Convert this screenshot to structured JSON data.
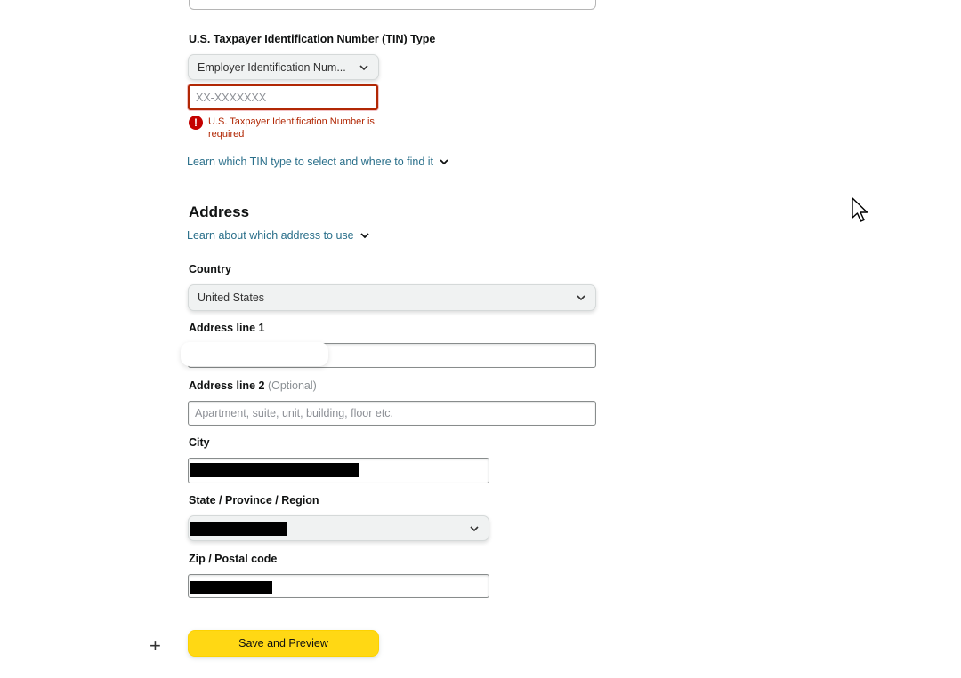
{
  "tin": {
    "section_label": "U.S. Taxpayer Identification Number (TIN) Type",
    "type_select_value": "Employer Identification Num...",
    "input_value": "",
    "input_placeholder": "XX-XXXXXXX",
    "error_message": "U.S. Taxpayer Identification Number is required",
    "error_icon": "alert-circle-icon",
    "help_link": "Learn which TIN type to select and where to find it"
  },
  "address": {
    "heading": "Address",
    "help_link": "Learn about which address to use",
    "country_label": "Country",
    "country_value": "United States",
    "line1_label": "Address line 1",
    "line1_value": "",
    "line2_label": "Address line 2",
    "line2_optional": "(Optional)",
    "line2_placeholder": "Apartment, suite, unit, building, floor etc.",
    "city_label": "City",
    "city_value": "",
    "state_label": "State / Province / Region",
    "state_value": "",
    "zip_label": "Zip / Postal code",
    "zip_value": ""
  },
  "actions": {
    "save_preview_label": "Save and Preview",
    "add_icon": "plus-icon"
  },
  "colors": {
    "primary_button": "#ffd814",
    "error": "#b12704",
    "link": "#2a6f8a"
  }
}
